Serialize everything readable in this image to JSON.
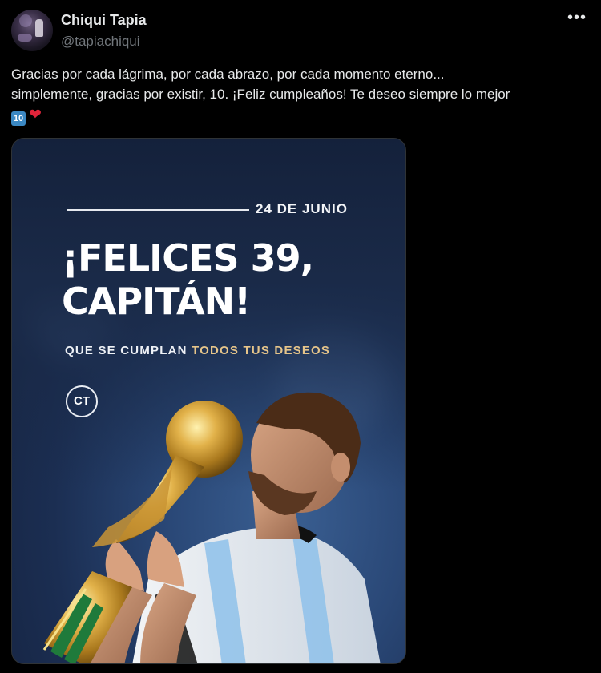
{
  "author": {
    "name": "Chiqui Tapia",
    "handle": "@tapiachiqui"
  },
  "more_icon": "more-horizontal-icon",
  "tweet": {
    "line1": "Gracias por cada lágrima, por cada abrazo, por cada momento eterno...",
    "line2": "simplemente, gracias por existir, 10. ¡Feliz cumpleaños! Te deseo siempre lo mejor",
    "emoji_keycap": "10",
    "emoji_heart": "❤"
  },
  "image": {
    "date": "24 DE JUNIO",
    "headline_line1": "¡FELICES 39,",
    "headline_line2": "CAPITÁN!",
    "sub_plain": "QUE SE CUMPLAN ",
    "sub_gold": "TODOS TUS DESEOS",
    "logo_text": "CT"
  },
  "colors": {
    "background": "#000000",
    "text": "#e7e9ea",
    "secondary": "#71767b",
    "gold_accent": "#e6c58a",
    "heart": "#e0243a",
    "keycap_blue": "#3b88c3"
  }
}
